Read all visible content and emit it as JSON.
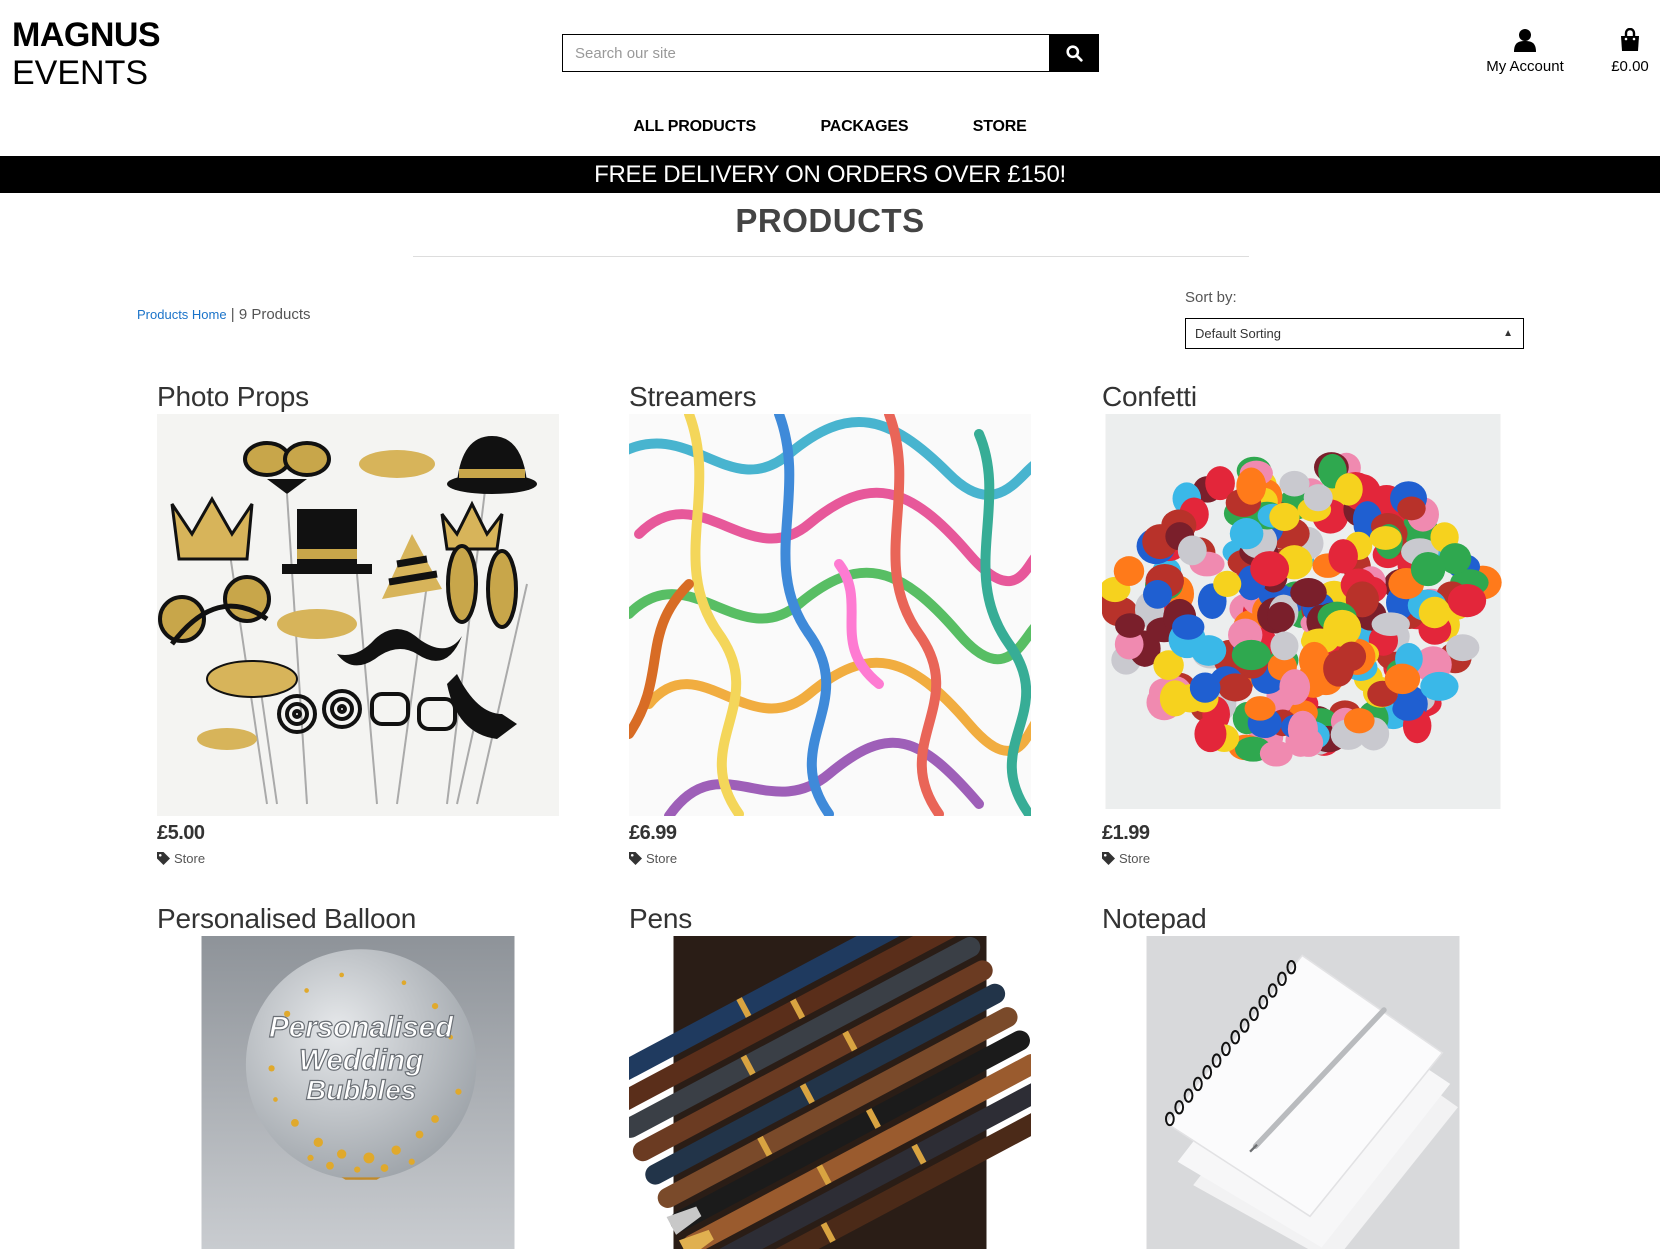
{
  "brand": {
    "line1": "MAGNUS",
    "line2": "EVENTS"
  },
  "search": {
    "placeholder": "Search our site"
  },
  "account": {
    "label": "My Account"
  },
  "bag": {
    "total": "£0.00"
  },
  "nav": [
    {
      "label": "ALL PRODUCTS"
    },
    {
      "label": "PACKAGES"
    },
    {
      "label": "STORE"
    }
  ],
  "banner": {
    "text": "FREE DELIVERY ON ORDERS OVER £150!"
  },
  "page": {
    "title": "PRODUCTS"
  },
  "breadcrumb": {
    "home_label": "Products Home",
    "separator": " | ",
    "count": "9 Products"
  },
  "sort": {
    "label": "Sort by:",
    "selected": "Default Sorting"
  },
  "products": [
    {
      "name": "Photo Props",
      "price": "£5.00",
      "category": "Store"
    },
    {
      "name": "Streamers",
      "price": "£6.99",
      "category": "Store"
    },
    {
      "name": "Confetti",
      "price": "£1.99",
      "category": "Store"
    },
    {
      "name": "Personalised Balloon",
      "price": "",
      "category": ""
    },
    {
      "name": "Pens",
      "price": "",
      "category": ""
    },
    {
      "name": "Notepad",
      "price": "",
      "category": ""
    }
  ],
  "balloon_image_text": [
    "Personalised",
    "Wedding",
    "Bubbles"
  ],
  "colors": {
    "black": "#000000",
    "link": "#1a73c9",
    "text": "#333333"
  }
}
